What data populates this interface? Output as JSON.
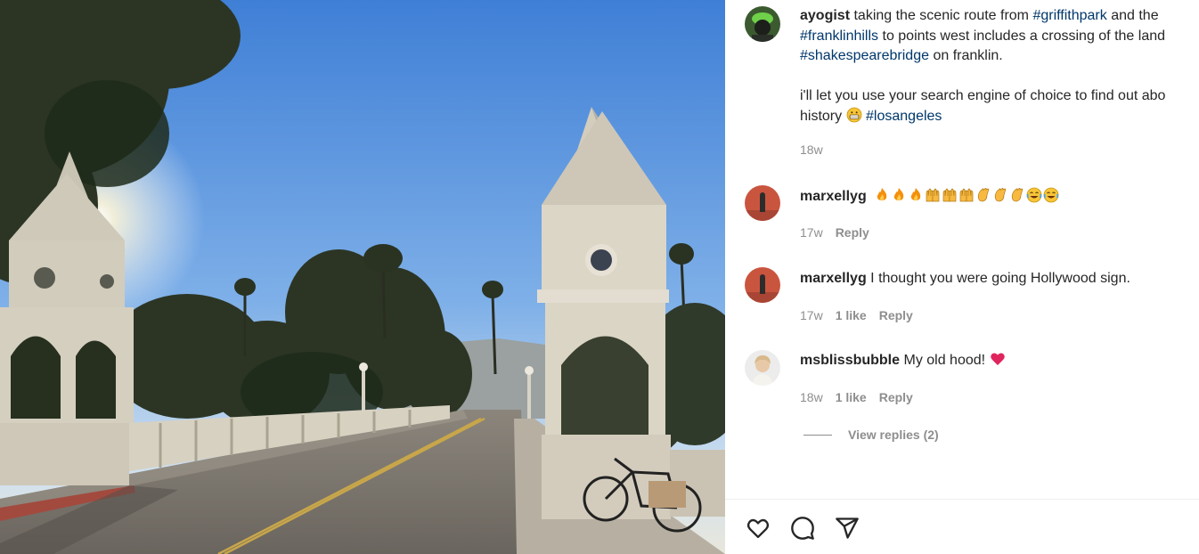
{
  "post": {
    "username": "ayogist",
    "caption_line1": "taking the scenic route from ",
    "tag_griffith": "#griffithpark",
    "caption_line1b": " and the",
    "tag_franklin": "#franklinhills",
    "caption_line2b": " to points west includes a crossing of the land",
    "tag_shakespeare": "#shakespearebridge",
    "caption_line3b": " on franklin.",
    "caption_para2_line1": "i'll let you use your search engine of choice to find out abo",
    "caption_para2_line2": "history",
    "tag_la": "#losangeles",
    "time": "18w"
  },
  "comments": [
    {
      "username": "marxellyg",
      "text": "",
      "emojis": [
        "fire-emoji",
        "fire-emoji",
        "fire-emoji",
        "raising-hands-emoji",
        "raising-hands-emoji",
        "raising-hands-emoji",
        "clapping-hands-emoji",
        "clapping-hands-emoji",
        "clapping-hands-emoji",
        "joy-face-emoji",
        "joy-face-emoji"
      ],
      "time": "17w",
      "likes": "",
      "reply": "Reply"
    },
    {
      "username": "marxellyg",
      "text": "I thought you were going Hollywood sign.",
      "time": "17w",
      "likes": "1 like",
      "reply": "Reply"
    },
    {
      "username": "msblissbubble",
      "text": "My old hood!",
      "time": "18w",
      "likes": "1 like",
      "reply": "Reply"
    }
  ],
  "view_replies": "View replies (2)",
  "actions": [
    "heart-icon",
    "comment-icon",
    "share-icon"
  ],
  "colors": {
    "hashtag": "#00376b",
    "muted": "#8e8e8e",
    "text": "#262626",
    "heart_red": "#e0245e"
  }
}
